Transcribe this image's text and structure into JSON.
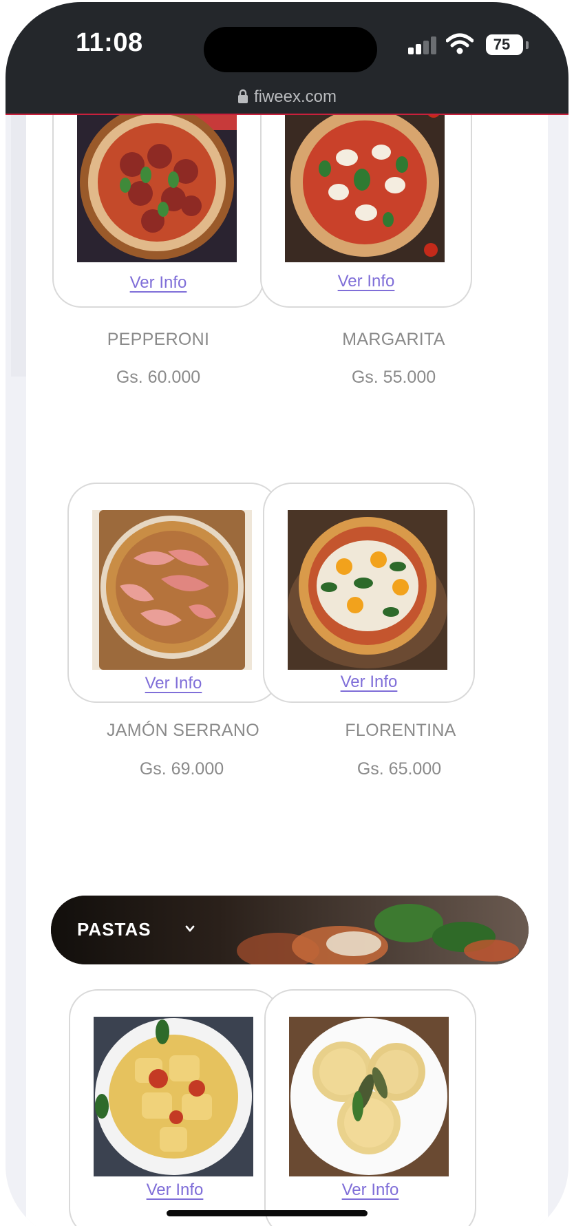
{
  "status_bar": {
    "time": "11:08",
    "battery": "75",
    "url": "fiweex.com"
  },
  "menu": {
    "items_row1": [
      {
        "name": "PEPPERONI",
        "price": "Gs. 60.000",
        "link": "Ver Info",
        "image": "pepperoni-pizza-image"
      },
      {
        "name": "MARGARITA",
        "price": "Gs. 55.000",
        "link": "Ver Info",
        "image": "margherita-pizza-image"
      }
    ],
    "items_row2": [
      {
        "name": "JAMÓN SERRANO",
        "price": "Gs. 69.000",
        "link": "Ver Info",
        "image": "serrano-ham-pizza-image"
      },
      {
        "name": "FLORENTINA",
        "price": "Gs. 65.000",
        "link": "Ver Info",
        "image": "florentina-pizza-image"
      }
    ],
    "category": {
      "label": "PASTAS",
      "icon": "chevron-down-icon"
    },
    "items_row3": [
      {
        "link": "Ver Info",
        "image": "ravioli-tomato-image"
      },
      {
        "link": "Ver Info",
        "image": "ravioli-sage-image"
      }
    ]
  },
  "colors": {
    "status_bg": "#24272b",
    "link": "#7f6ed8",
    "text_muted": "#8a8a8a",
    "card_border": "#d9d9d9"
  }
}
